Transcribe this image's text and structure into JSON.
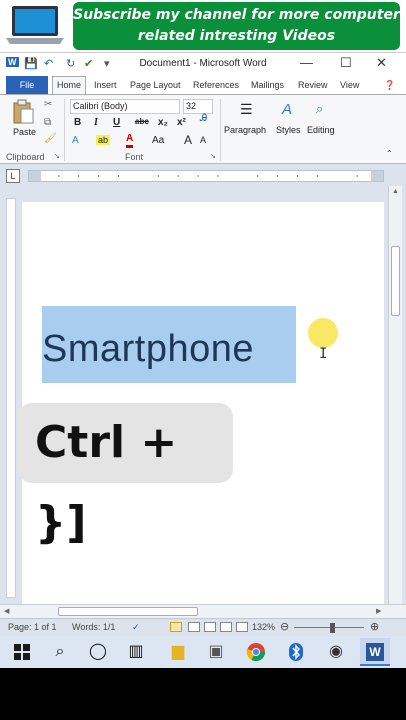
{
  "banner": {
    "line1": "Subscribe my channel for more computer",
    "line2": "related intresting Videos"
  },
  "window": {
    "title": "Document1 - Microsoft Word",
    "buttons": {
      "minimize": "—",
      "maximize": "☐",
      "close": "✕"
    }
  },
  "ribbon": {
    "tabs": [
      "File",
      "Home",
      "Insert",
      "Page Layout",
      "References",
      "Mailings",
      "Review",
      "View"
    ],
    "clipboard": {
      "paste_label": "Paste",
      "group_label": "Clipboard"
    },
    "font": {
      "name": "Calibri (Body)",
      "size": "32",
      "group_label": "Font",
      "bold": "B",
      "italic": "I",
      "underline": "U",
      "strike": "abc",
      "subscript": "x₂",
      "superscript": "x²",
      "font_color": "A",
      "change_case": "Aa",
      "grow": "A",
      "shrink": "A"
    },
    "paragraph_label": "Paragraph",
    "styles_label": "Styles",
    "editing_label": "Editing"
  },
  "document": {
    "selected_text": "Smartphone"
  },
  "overlay": {
    "shortcut": "Ctrl + }]"
  },
  "statusbar": {
    "page": "Page: 1 of 1",
    "words": "Words: 1/1",
    "zoom": "132%"
  },
  "colors": {
    "banner_green": "#0a8f3a",
    "file_tab_blue": "#2a62b8",
    "selection_blue": "#a9cdee",
    "highlight_yellow": "#f7e032"
  }
}
